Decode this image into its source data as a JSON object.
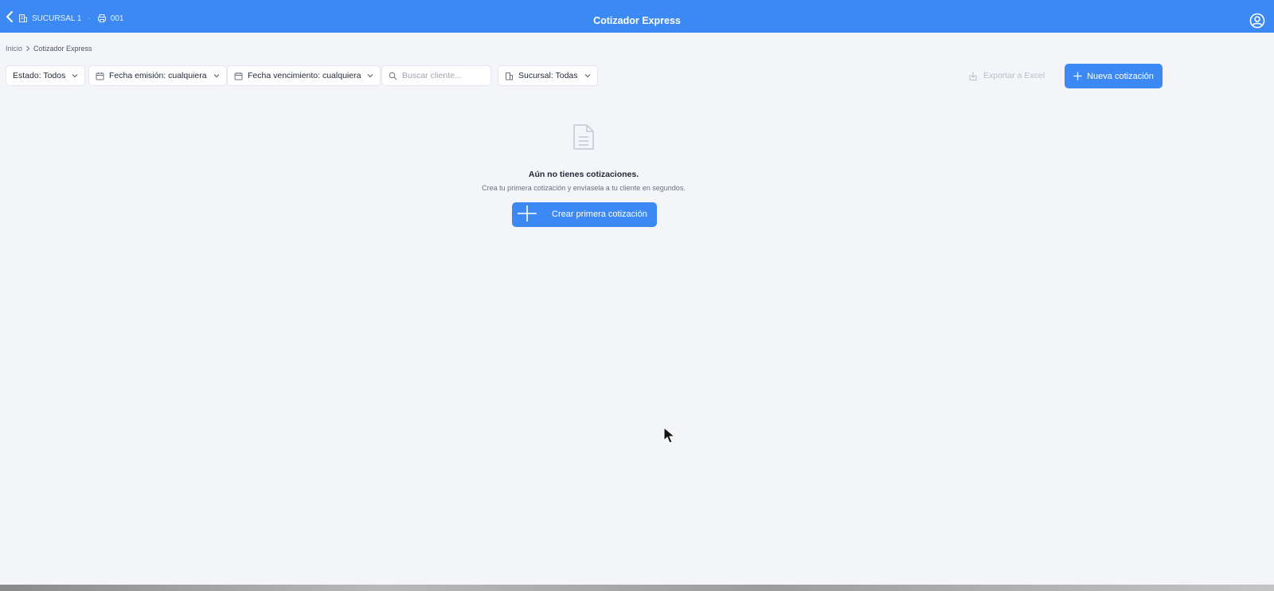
{
  "topbar": {
    "title": "Cotizador Express",
    "branch": "SUCURSAL 1",
    "register": "001",
    "separator": "·",
    "back_icon": "chevron-left-icon",
    "branch_icon": "building-icon",
    "register_icon": "printer-icon",
    "user_icon": "user-circle-icon"
  },
  "breadcrumb": {
    "home": "Inicio",
    "separator": ">",
    "current": "Cotizador Express"
  },
  "filters": {
    "estado": "Estado: Todos",
    "fecha_emision": "Fecha emisión: cualquiera",
    "fecha_vencimiento": "Fecha vencimiento: cualquiera",
    "search_placeholder": "Buscar cliente...",
    "sucursal": "Sucursal: Todas"
  },
  "actions": {
    "export_label": "Exportar a Excel",
    "new_label": "Nueva cotización"
  },
  "empty_state": {
    "title": "Aún no tienes cotizaciones.",
    "subtitle": "Crea tu primera cotización y envíasela a tu cliente en segundos.",
    "button_label": "Crear primera cotización",
    "icon": "document-icon"
  },
  "colors": {
    "primary": "#3d89f3",
    "background": "#f3f5f8",
    "disabled_text": "#b8bec8"
  }
}
